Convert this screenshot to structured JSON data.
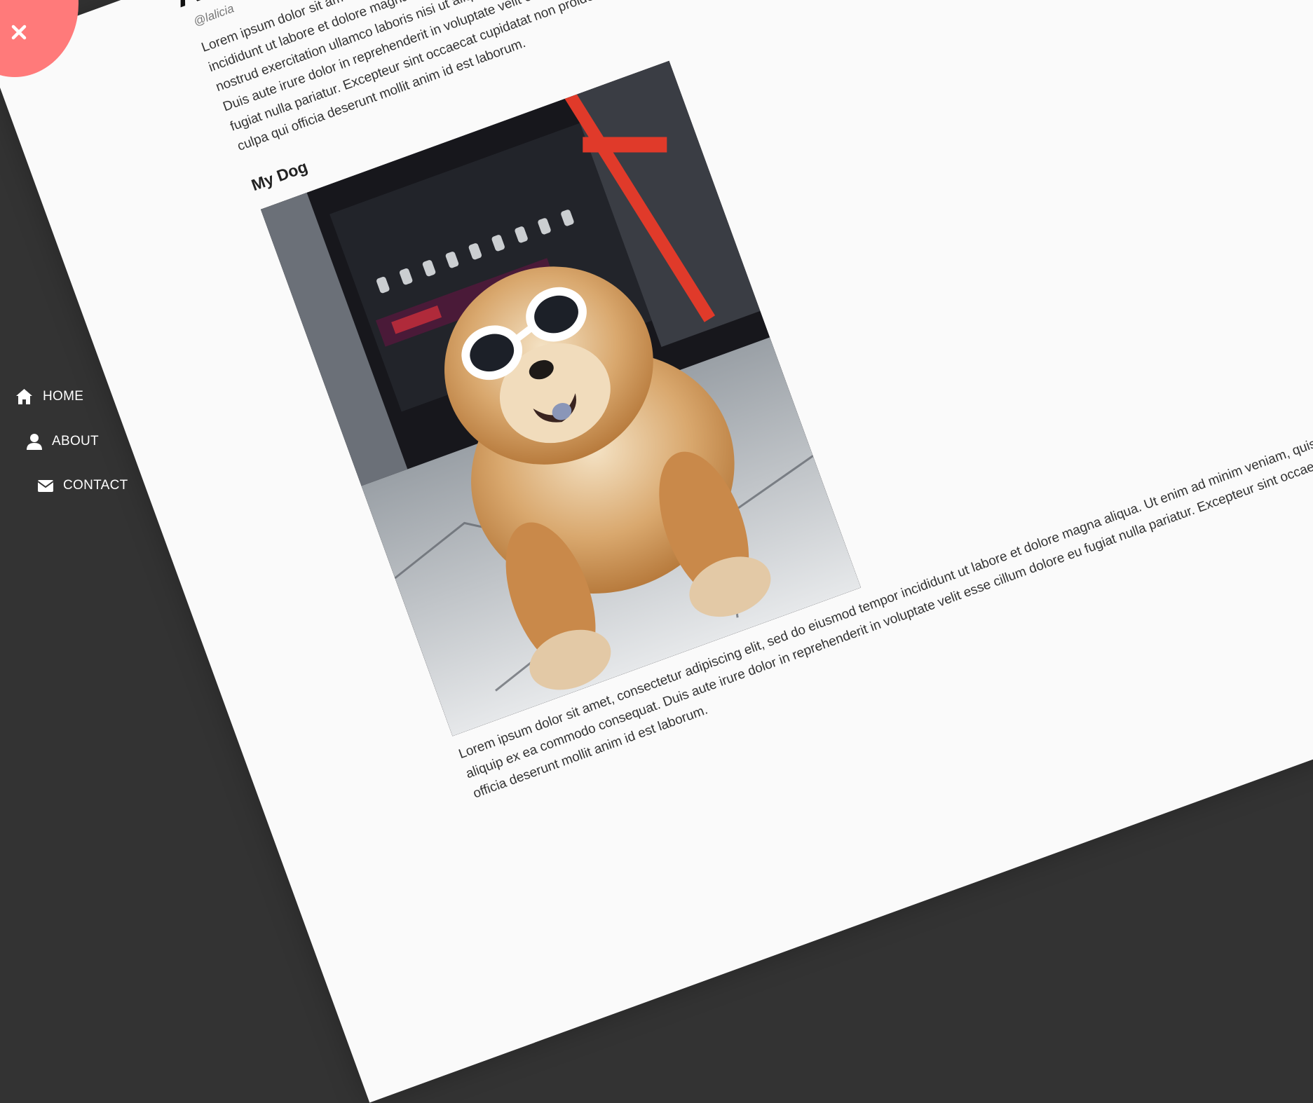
{
  "article": {
    "title": "Am",
    "author": "@lalicia",
    "intro": "Lorem ipsum dolor sit amet, consectetur adipiscing elit, sed do eiusmod tempor incididunt ut labore et dolore magna aliqua. Ut enim ad minim veniam, quis nostrud exercitation ullamco laboris nisi ut aliquip ex ea commodo consequat. Duis aute irure dolor in reprehenderit in voluptate velit esse cillum dolore eu fugiat nulla pariatur. Excepteur sint occaecat cupidatat non proident, sunt in culpa qui officia deserunt mollit anim id est laborum.",
    "subheading": "My Dog",
    "body": "Lorem ipsum dolor sit amet, consectetur adipiscing elit, sed do eiusmod tempor incididunt ut labore et dolore magna aliqua. Ut enim ad minim veniam, quis nostrud exercitation ullamco laboris nisi ut aliquip ex ea commodo consequat. Duis aute irure dolor in reprehenderit in voluptate velit esse cillum dolore eu fugiat nulla pariatur. Excepteur sint occaecat cupidatat non proident, sunt in culpa qui officia deserunt mollit anim id est laborum."
  },
  "nav": {
    "items": [
      {
        "label": "HOME",
        "icon": "home-icon"
      },
      {
        "label": "ABOUT",
        "icon": "user-icon"
      },
      {
        "label": "CONTACT",
        "icon": "envelope-icon"
      }
    ]
  },
  "close_button": {
    "icon": "close-icon"
  },
  "colors": {
    "sidebar": "#333333",
    "page": "#fafafa",
    "close_button": "#ff7a7a",
    "nav_text": "#ffffff"
  }
}
